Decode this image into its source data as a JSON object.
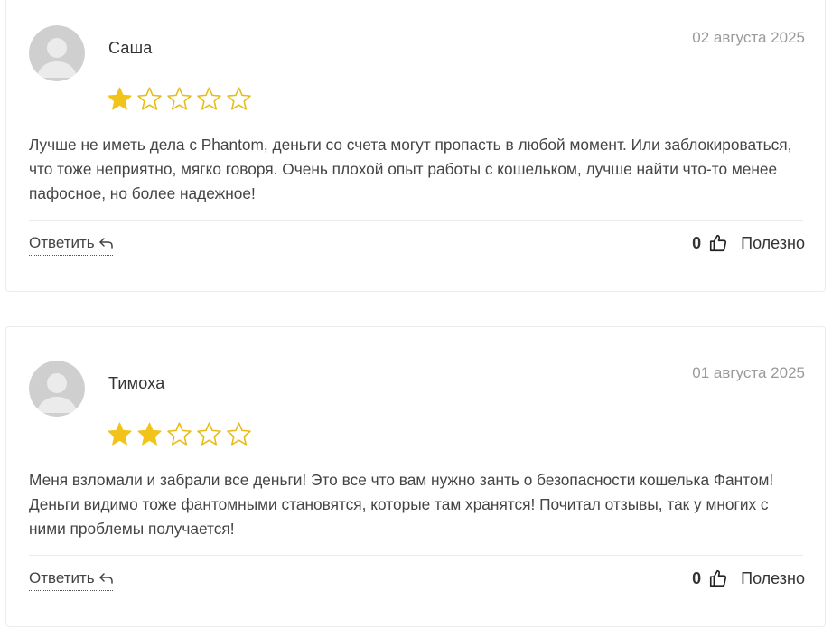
{
  "colors": {
    "star_filled": "#f2c318",
    "star_empty_stroke": "#e9bb14",
    "date_text": "#9a9a9a",
    "avatar_bg": "#cfcfcf",
    "avatar_fg": "#ebebeb"
  },
  "reviews": [
    {
      "author": "Саша",
      "date": "02 августа 2025",
      "rating": 1,
      "rating_max": 5,
      "text": "Лучше не иметь дела с Phantom, деньги со счета могут пропасть в любой момент. Или заблокироваться, что тоже неприятно, мягко говоря. Очень плохой опыт работы с кошельком, лучше найти что-то менее пафосное, но более надежное!",
      "reply_label": "Ответить",
      "helpful_count": "0",
      "helpful_label": "Полезно"
    },
    {
      "author": "Тимоха",
      "date": "01 августа 2025",
      "rating": 2,
      "rating_max": 5,
      "text": "Меня взломали и забрали все деньги! Это все что вам нужно занть о безопасности кошелька Фантом! Деньги видимо тоже фантомными становятся, которые там хранятся! Почитал отзывы, так у многих с ними проблемы получается!",
      "reply_label": "Ответить",
      "helpful_count": "0",
      "helpful_label": "Полезно"
    }
  ],
  "icons": {
    "reply": "reply-arrow-icon",
    "helpful": "thumbs-up-icon",
    "avatar": "user-avatar-icon"
  }
}
